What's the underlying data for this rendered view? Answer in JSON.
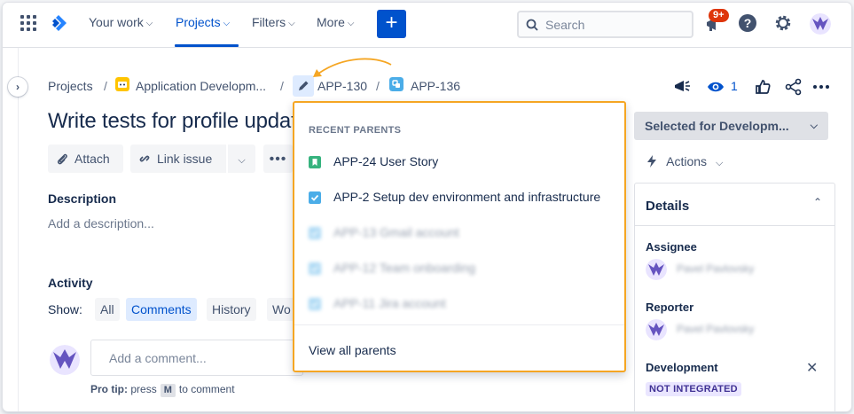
{
  "nav": {
    "your_work": "Your work",
    "projects": "Projects",
    "filters": "Filters",
    "more": "More",
    "create": "+",
    "search_placeholder": "Search",
    "notif_badge": "9+",
    "help": "?"
  },
  "breadcrumb": {
    "projects": "Projects",
    "project": "Application Developm...",
    "parent_key": "APP-130",
    "issue_key": "APP-136"
  },
  "header_actions": {
    "watch_count": "1"
  },
  "issue": {
    "title": "Write tests for profile updat",
    "attach": "Attach",
    "link_issue": "Link issue",
    "description_label": "Description",
    "description_placeholder": "Add a description...",
    "activity_label": "Activity",
    "show_label": "Show:",
    "filters": [
      "All",
      "Comments",
      "History",
      "Wo"
    ],
    "comment_placeholder": "Add a comment...",
    "protip_bold": "Pro tip:",
    "protip_press": "press",
    "protip_key": "M",
    "protip_rest": "to comment"
  },
  "side": {
    "status": "Selected for Developm...",
    "actions": "Actions",
    "details_title": "Details",
    "assignee_label": "Assignee",
    "assignee_name": "Pavel Pavlovsky",
    "reporter_label": "Reporter",
    "reporter_name": "Pavel Pavlovsky",
    "development_label": "Development",
    "development_status": "NOT INTEGRATED"
  },
  "dropdown": {
    "header": "RECENT PARENTS",
    "items": [
      {
        "label": "APP-24 User Story"
      },
      {
        "label": "APP-2 Setup dev environment and infrastructure"
      },
      {
        "label": "APP-13 Gmail account"
      },
      {
        "label": "APP-12 Team onboarding"
      },
      {
        "label": "APP-11 Jira account"
      }
    ],
    "footer": "View all parents"
  },
  "colors": {
    "brand": "#0052cc",
    "highlight": "#f5a623",
    "story_green": "#36b37e",
    "task_blue": "#4bade8",
    "avatar_purple": "#6554c0"
  },
  "icons": {
    "apps": "apps-grid-icon",
    "logo": "jira-logo-icon",
    "search": "search-icon",
    "notifications": "megaphone-icon",
    "help": "help-icon",
    "settings": "gear-icon",
    "feedback": "feedback-icon",
    "watch": "eye-icon",
    "like": "thumbs-up-icon",
    "share": "share-icon",
    "more": "more-icon"
  }
}
